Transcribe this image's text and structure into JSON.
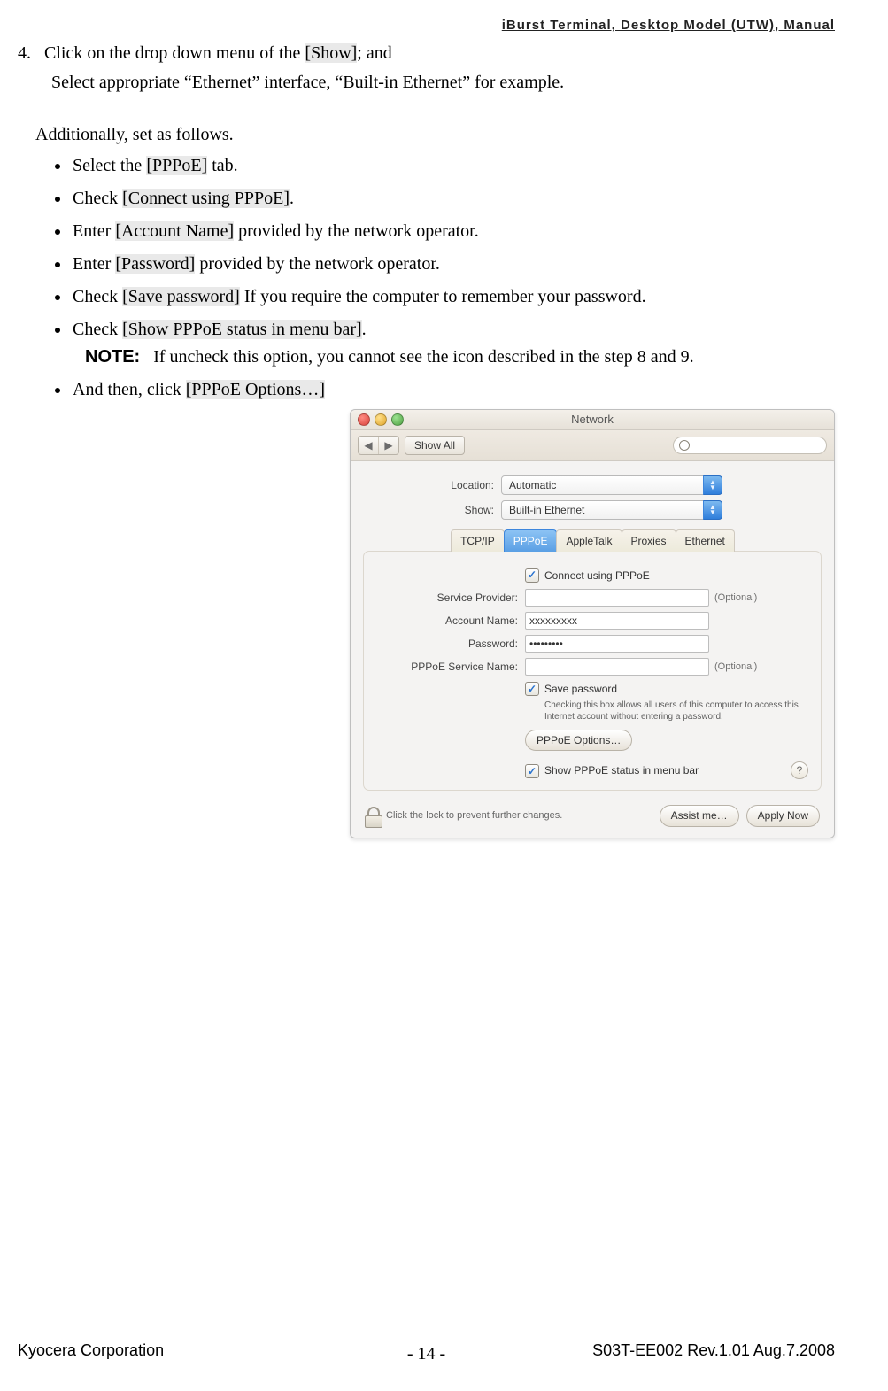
{
  "header": {
    "doc_title": "iBurst Terminal, Desktop Model (UTW), Manual"
  },
  "body": {
    "step_num": "4.",
    "step_line_a_pre": "Click on the drop down menu of the ",
    "step_line_a_boxed": "[Show]",
    "step_line_a_post": "; and",
    "step_line_b": "Select appropriate “Ethernet” interface, “Built-in Ethernet” for example.",
    "additionally": "Additionally, set as follows.",
    "bullets": [
      {
        "pre": "Select the ",
        "boxed": "[PPPoE]",
        "post": " tab."
      },
      {
        "pre": "Check ",
        "boxed": "[Connect using PPPoE]",
        "post": "."
      },
      {
        "pre": "Enter ",
        "boxed": "[Account Name]",
        "post": " provided by the network operator."
      },
      {
        "pre": "Enter ",
        "boxed": "[Password]",
        "post": " provided by the network operator."
      },
      {
        "pre": "Check ",
        "boxed": "[Save password]",
        "post": " If you require the computer to remember your password."
      },
      {
        "pre": "Check ",
        "boxed": "[Show PPPoE status in menu bar]",
        "post": "."
      }
    ],
    "note_label": "NOTE:",
    "note_text": "If uncheck this option, you cannot see the icon described in the step 8 and 9.",
    "and_then_pre": "And then, click ",
    "and_then_boxed": "[PPPoE Options…]"
  },
  "mac": {
    "title": "Network",
    "show_all": "Show All",
    "location_label": "Location:",
    "location_value": "Automatic",
    "show_label": "Show:",
    "show_value": "Built-in Ethernet",
    "tabs": [
      "TCP/IP",
      "PPPoE",
      "AppleTalk",
      "Proxies",
      "Ethernet"
    ],
    "connect_using": "Connect using PPPoE",
    "service_provider_label": "Service Provider:",
    "account_name_label": "Account Name:",
    "account_name_value": "xxxxxxxxx",
    "password_label": "Password:",
    "password_value": "•••••••••",
    "pppoe_service_name_label": "PPPoE Service Name:",
    "optional": "(Optional)",
    "save_password": "Save password",
    "save_password_hint": "Checking this box allows all users of this computer to access this Internet account without entering a password.",
    "pppoe_options_btn": "PPPoE Options…",
    "show_status": "Show PPPoE status in menu bar",
    "lock_text": "Click the lock to prevent further changes.",
    "assist_me": "Assist me…",
    "apply_now": "Apply Now"
  },
  "footer": {
    "company": "Kyocera Corporation",
    "rev": "S03T-EE002 Rev.1.01 Aug.7.2008",
    "page": "- 14 -"
  }
}
